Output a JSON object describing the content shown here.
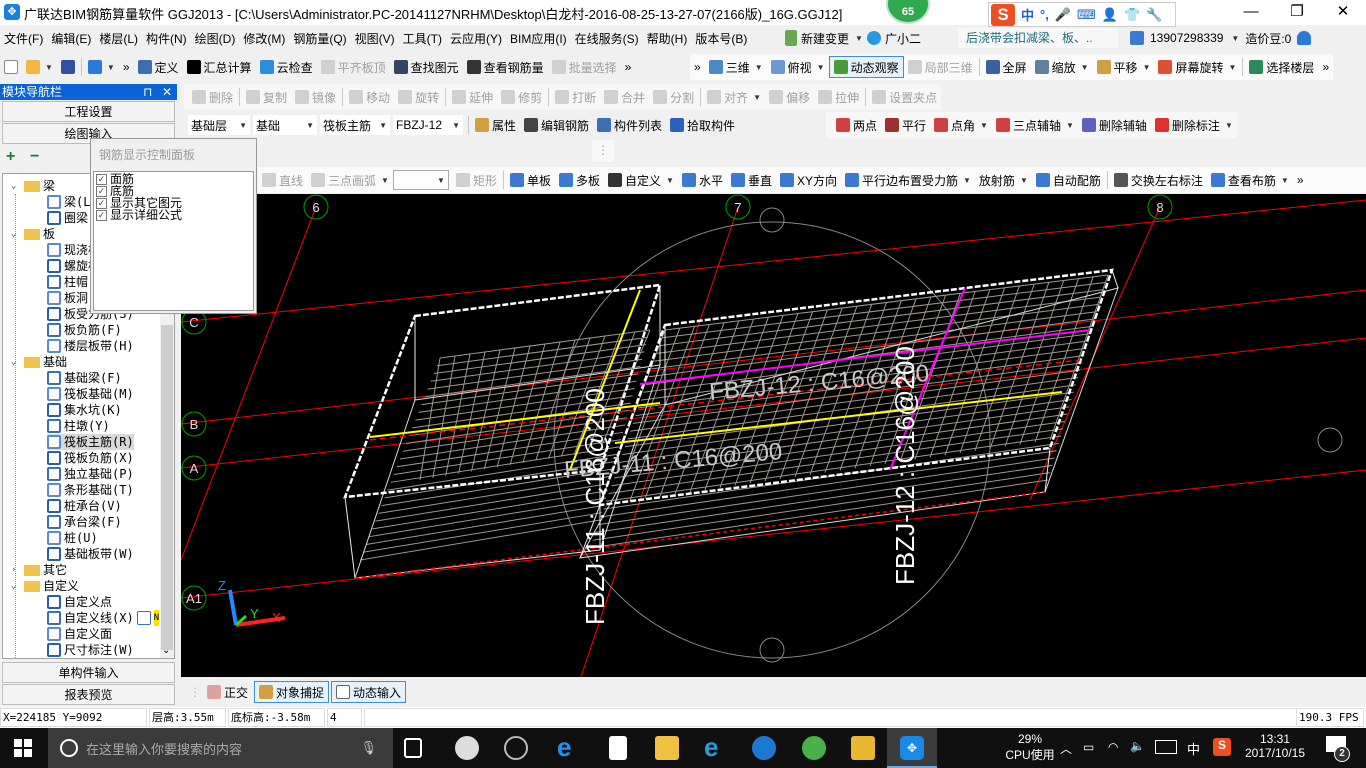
{
  "titlebar": {
    "title": "广联达BIM钢筋算量软件 GGJ2013 - [C:\\Users\\Administrator.PC-20141127NRHM\\Desktop\\白龙村-2016-08-25-13-27-07(2166版)_16G.GGJ12]",
    "badge": "65",
    "minimize": "—",
    "restore": "❐",
    "close": "✕",
    "ime": {
      "logo": "S",
      "items": [
        "中",
        "°,",
        "🎤",
        "⌨",
        "👤",
        "👕",
        "🔧"
      ]
    }
  },
  "menubar": {
    "items": [
      "文件(F)",
      "编辑(E)",
      "楼层(L)",
      "构件(N)",
      "绘图(D)",
      "修改(M)",
      "钢筋量(Q)",
      "视图(V)",
      "工具(T)",
      "云应用(Y)",
      "BIM应用(I)",
      "在线服务(S)",
      "帮助(H)",
      "版本号(B)"
    ],
    "new_change": "新建变更",
    "assistant": "广小二",
    "notice": "后浇带会扣减梁、板、..",
    "account": "13907298339",
    "beans": "造价豆:0"
  },
  "toolbar1": {
    "left": [
      {
        "label": "",
        "icon": "new-file-icon",
        "color": "#ffffff"
      },
      {
        "label": "",
        "icon": "open-folder-icon",
        "color": "#f0b840",
        "dropdown": true
      },
      {
        "label": "",
        "icon": "save-icon",
        "color": "#3050a0"
      },
      {
        "sep": true
      },
      {
        "label": "",
        "icon": "undo-icon",
        "color": "#2a7ad8",
        "dropdown": true
      },
      {
        "label": "»",
        "icon": "",
        "color": ""
      },
      {
        "label": "定义",
        "icon": "define-icon",
        "color": "#3a6fb0"
      },
      {
        "label": "汇总计算",
        "icon": "sigma-icon",
        "color": "#000000"
      },
      {
        "label": "云检查",
        "icon": "cloud-check-icon",
        "color": "#2a8ee0"
      },
      {
        "label": "平齐板顶",
        "icon": "align-slab-icon",
        "color": "#c0c0c0",
        "disabled": true
      },
      {
        "label": "查找图元",
        "icon": "binoculars-icon",
        "color": "#334466"
      },
      {
        "label": "查看钢筋量",
        "icon": "glasses-icon",
        "color": "#333333"
      },
      {
        "label": "批量选择",
        "icon": "batch-select-icon",
        "color": "#c0c0c0",
        "disabled": true
      },
      {
        "label": "»",
        "icon": "",
        "color": ""
      }
    ],
    "right": [
      {
        "label": "»",
        "icon": "",
        "color": ""
      },
      {
        "label": "三维",
        "icon": "cube-icon",
        "color": "#4a8ac8",
        "dropdown": true
      },
      {
        "label": "俯视",
        "icon": "top-view-icon",
        "color": "#6a9ad0",
        "dropdown": true
      },
      {
        "label": "动态观察",
        "icon": "orbit-icon",
        "color": "#4a9a3a",
        "active": true
      },
      {
        "label": "局部三维",
        "icon": "local-3d-icon",
        "color": "#c0c0c0",
        "disabled": true
      },
      {
        "sep": true
      },
      {
        "label": "全屏",
        "icon": "fullscreen-icon",
        "color": "#3a60a0"
      },
      {
        "label": "缩放",
        "icon": "zoom-icon",
        "color": "#6080a0",
        "dropdown": true
      },
      {
        "label": "平移",
        "icon": "pan-hand-icon",
        "color": "#d0a040",
        "dropdown": true
      },
      {
        "label": "屏幕旋转",
        "icon": "rotate-screen-icon",
        "color": "#e05030",
        "dropdown": true
      },
      {
        "sep": true
      },
      {
        "label": "选择楼层",
        "icon": "floor-select-icon",
        "color": "#2a8a5a"
      },
      {
        "label": "»",
        "icon": "",
        "color": ""
      }
    ]
  },
  "toolbar2": [
    {
      "label": "删除",
      "icon": "delete-icon",
      "disabled": true
    },
    {
      "sep": true
    },
    {
      "label": "复制",
      "icon": "copy-icon",
      "disabled": true
    },
    {
      "label": "镜像",
      "icon": "mirror-icon",
      "disabled": true
    },
    {
      "sep": true
    },
    {
      "label": "移动",
      "icon": "move-icon",
      "disabled": true
    },
    {
      "label": "旋转",
      "icon": "rotate-icon",
      "disabled": true
    },
    {
      "sep": true
    },
    {
      "label": "延伸",
      "icon": "extend-icon",
      "disabled": true
    },
    {
      "label": "修剪",
      "icon": "trim-icon",
      "disabled": true
    },
    {
      "sep": true
    },
    {
      "label": "打断",
      "icon": "break-icon",
      "disabled": true
    },
    {
      "label": "合并",
      "icon": "merge-icon",
      "disabled": true
    },
    {
      "label": "分割",
      "icon": "split-icon",
      "disabled": true
    },
    {
      "sep": true
    },
    {
      "label": "对齐",
      "icon": "align-icon",
      "disabled": true,
      "dropdown": true
    },
    {
      "label": "偏移",
      "icon": "offset-icon",
      "disabled": true
    },
    {
      "label": "拉伸",
      "icon": "stretch-icon",
      "disabled": true
    },
    {
      "sep": true
    },
    {
      "label": "设置夹点",
      "icon": "grip-icon",
      "disabled": true
    }
  ],
  "toolbar3": {
    "selects": [
      {
        "name": "floor-select",
        "value": "基础层"
      },
      {
        "name": "category-select",
        "value": "基础"
      },
      {
        "name": "type-select",
        "value": "筏板主筋"
      },
      {
        "name": "component-select",
        "value": "FBZJ-12"
      }
    ],
    "items": [
      {
        "label": "属性",
        "icon": "properties-icon",
        "color": "#d0a040"
      },
      {
        "label": "编辑钢筋",
        "icon": "edit-rebar-icon",
        "color": "#444444"
      },
      {
        "label": "构件列表",
        "icon": "component-list-icon",
        "color": "#3a6fb0"
      },
      {
        "label": "拾取构件",
        "icon": "eyedropper-icon",
        "color": "#2a60c0"
      }
    ],
    "axis_items": [
      {
        "label": "两点",
        "icon": "two-point-axis-icon",
        "color": "#d04040"
      },
      {
        "label": "平行",
        "icon": "parallel-axis-icon",
        "color": "#a03030"
      },
      {
        "label": "点角",
        "icon": "point-angle-axis-icon",
        "color": "#d04040",
        "dropdown": true
      },
      {
        "label": "三点辅轴",
        "icon": "three-point-axis-icon",
        "color": "#d04040",
        "dropdown": true
      },
      {
        "label": "删除辅轴",
        "icon": "delete-axis-icon",
        "color": "#6060c0"
      },
      {
        "label": "删除标注",
        "icon": "delete-dimension-icon",
        "color": "#e03030",
        "dropdown": true
      }
    ]
  },
  "toolbar5": [
    {
      "label": "直线",
      "icon": "line-icon",
      "disabled": true
    },
    {
      "label": "三点画弧",
      "icon": "arc-icon",
      "disabled": true,
      "dropdown": true
    },
    {
      "select": true,
      "value": ""
    },
    {
      "label": "矩形",
      "icon": "rectangle-icon",
      "disabled": true
    },
    {
      "sep": true
    },
    {
      "label": "单板",
      "icon": "single-slab-icon",
      "color": "#3a7ad0"
    },
    {
      "label": "多板",
      "icon": "multi-slab-icon",
      "color": "#3a7ad0"
    },
    {
      "label": "自定义",
      "icon": "custom-icon",
      "color": "#333333",
      "dropdown": true
    },
    {
      "label": "水平",
      "icon": "horizontal-icon",
      "color": "#3a7ad0"
    },
    {
      "label": "垂直",
      "icon": "vertical-icon",
      "color": "#3a7ad0"
    },
    {
      "label": "XY方向",
      "icon": "xy-direction-icon",
      "color": "#3a7ad0"
    },
    {
      "label": "平行边布置受力筋",
      "icon": "parallel-edge-icon",
      "color": "#3a7ad0",
      "dropdown": true
    },
    {
      "label": "放射筋",
      "icon": "",
      "color": "",
      "dropdown": true
    },
    {
      "label": "自动配筋",
      "icon": "auto-rebar-icon",
      "color": "#3a7ad0"
    },
    {
      "sep": true
    },
    {
      "label": "交换左右标注",
      "icon": "swap-label-icon",
      "color": "#555555"
    },
    {
      "label": "查看布筋",
      "icon": "view-rebar-icon",
      "color": "#3a7ad0",
      "dropdown": true
    },
    {
      "label": "»",
      "icon": "",
      "color": ""
    }
  ],
  "navpanel": {
    "title": "模块导航栏",
    "pin": "⊓",
    "close": "✕",
    "project_settings": "工程设置",
    "drawing_input": "绘图输入",
    "expand": "+",
    "collapse": "−",
    "single_input": "单构件输入",
    "report_preview": "报表预览",
    "tree": [
      {
        "label": "梁",
        "level": 0,
        "expanded": true
      },
      {
        "label": "梁(L)",
        "level": 1,
        "icon": "beam-icon"
      },
      {
        "label": "圈梁(E)",
        "level": 1,
        "icon": "ring-beam-icon"
      },
      {
        "label": "板",
        "level": 0,
        "expanded": true
      },
      {
        "label": "现浇板(B)",
        "level": 1,
        "icon": "cast-slab-icon"
      },
      {
        "label": "螺旋板(B)",
        "level": 1,
        "icon": "spiral-slab-icon"
      },
      {
        "label": "柱帽(V)",
        "level": 1,
        "icon": "column-cap-icon"
      },
      {
        "label": "板洞(N)",
        "level": 1,
        "icon": "slab-hole-icon"
      },
      {
        "label": "板受力筋(S)",
        "level": 1,
        "icon": "slab-rebar-icon"
      },
      {
        "label": "板负筋(F)",
        "level": 1,
        "icon": "slab-neg-rebar-icon"
      },
      {
        "label": "楼层板带(H)",
        "level": 1,
        "icon": "floor-strip-icon"
      },
      {
        "label": "基础",
        "level": 0,
        "expanded": true
      },
      {
        "label": "基础梁(F)",
        "level": 1,
        "icon": "foundation-beam-icon"
      },
      {
        "label": "筏板基础(M)",
        "level": 1,
        "icon": "raft-foundation-icon"
      },
      {
        "label": "集水坑(K)",
        "level": 1,
        "icon": "sump-icon"
      },
      {
        "label": "柱墩(Y)",
        "level": 1,
        "icon": "column-pier-icon"
      },
      {
        "label": "筏板主筋(R)",
        "level": 1,
        "icon": "raft-main-rebar-icon",
        "selected": true
      },
      {
        "label": "筏板负筋(X)",
        "level": 1,
        "icon": "raft-neg-rebar-icon"
      },
      {
        "label": "独立基础(P)",
        "level": 1,
        "icon": "isolated-footing-icon"
      },
      {
        "label": "条形基础(T)",
        "level": 1,
        "icon": "strip-footing-icon"
      },
      {
        "label": "桩承台(V)",
        "level": 1,
        "icon": "pile-cap-icon"
      },
      {
        "label": "承台梁(F)",
        "level": 1,
        "icon": "cap-beam-icon"
      },
      {
        "label": "桩(U)",
        "level": 1,
        "icon": "pile-icon"
      },
      {
        "label": "基础板带(W)",
        "level": 1,
        "icon": "foundation-strip-icon"
      },
      {
        "label": "其它",
        "level": 0,
        "expanded": false
      },
      {
        "label": "自定义",
        "level": 0,
        "expanded": true
      },
      {
        "label": "自定义点",
        "level": 1,
        "icon": "custom-point-icon"
      },
      {
        "label": "自定义线(X)",
        "level": 1,
        "icon": "custom-line-icon",
        "badge": "N"
      },
      {
        "label": "自定义面",
        "level": 1,
        "icon": "custom-face-icon"
      },
      {
        "label": "尺寸标注(W)",
        "level": 1,
        "icon": "dimension-icon"
      }
    ]
  },
  "rebar_panel": {
    "title": "钢筋显示控制面板",
    "options": [
      {
        "label": "面筋",
        "checked": true
      },
      {
        "label": "底筋",
        "checked": true
      },
      {
        "label": "显示其它图元",
        "checked": true
      },
      {
        "label": "显示详细公式",
        "checked": true
      }
    ]
  },
  "viewport": {
    "axes": [
      "6",
      "7",
      "8",
      "C",
      "B",
      "A",
      "A1"
    ],
    "labels": {
      "top_right": "FBZJ-12 : C16@200",
      "front_left": "FBZJ-11 : C16@200",
      "vertical_left": "FBZJ-11 : C16@200",
      "vertical_right": "FBZJ-12 : C16@200"
    },
    "coord_axes": {
      "x": "X",
      "y": "Y",
      "z": "Z"
    },
    "colors": {
      "axis_line": "#ff0000",
      "axis_circle": "#00a000",
      "mesh": "#a09890",
      "edge": "#ffffff",
      "yellow": "#ffff00",
      "magenta": "#ff00ff"
    }
  },
  "bottombar": {
    "ortho": "正交",
    "snap": "对象捕捉",
    "dynamic_input": "动态输入"
  },
  "statusbar": {
    "coords": "X=224185 Y=9092",
    "floor_height": "层高:3.55m",
    "bottom_elev": "底标高:-3.58m",
    "count": "4",
    "fps": "190.3 FPS"
  },
  "taskbar": {
    "search_placeholder": "在这里输入你要搜索的内容",
    "cpu_percent": "29%",
    "cpu_label": "CPU使用",
    "lang": "中",
    "time": "13:31",
    "date": "2017/10/15",
    "notifications": "2"
  }
}
